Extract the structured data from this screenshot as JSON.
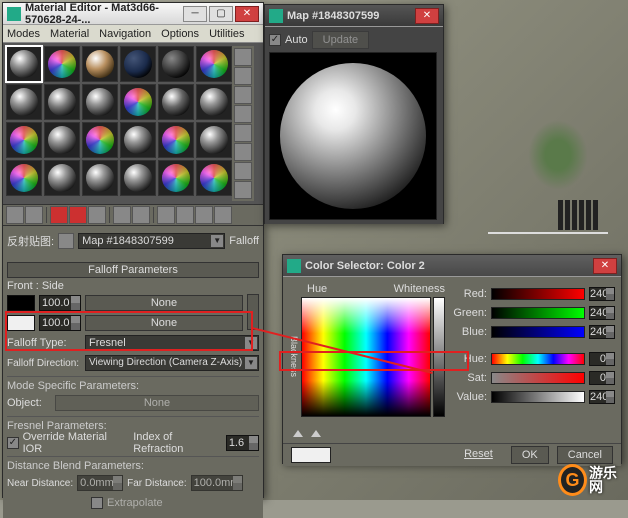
{
  "materialEditor": {
    "title": "Material Editor - Mat3d66-570628-24-...",
    "menu": [
      "Modes",
      "Material",
      "Navigation",
      "Options",
      "Utilities"
    ],
    "mapField": "Map #1848307599",
    "mapType": "Falloff",
    "reflectMapLabel": "反射贴图:",
    "falloffRoll": "Falloff Parameters",
    "frontSideLabel": "Front : Side",
    "slot1": {
      "value": "100.0",
      "map": "None"
    },
    "slot2": {
      "value": "100.0",
      "map": "None"
    },
    "falloffTypeLabel": "Falloff Type:",
    "falloffType": "Fresnel",
    "falloffDirLabel": "Falloff Direction:",
    "falloffDir": "Viewing Direction (Camera Z-Axis)",
    "modeSpecLabel": "Mode Specific Parameters:",
    "objectLabel": "Object:",
    "objectBtn": "None",
    "fresnelLabel": "Fresnel Parameters:",
    "overrideIOR": "Override Material IOR",
    "iorLabel": "Index of Refraction",
    "iorValue": "1.6",
    "distBlendLabel": "Distance Blend Parameters:",
    "nearDistLabel": "Near Distance:",
    "nearDist": "0.0mm",
    "farDistLabel": "Far Distance:",
    "farDist": "100.0mm",
    "extrapolate": "Extrapolate"
  },
  "mapPreview": {
    "title": "Map #1848307599",
    "auto": "Auto",
    "update": "Update"
  },
  "colorSelector": {
    "title": "Color Selector: Color 2",
    "hueLabel": "Hue",
    "whitenessLabel": "Whiteness",
    "blacknessLabel": "Blackness",
    "red": {
      "label": "Red:",
      "value": "240"
    },
    "green": {
      "label": "Green:",
      "value": "240"
    },
    "blue": {
      "label": "Blue:",
      "value": "240"
    },
    "hue": {
      "label": "Hue:",
      "value": "0"
    },
    "sat": {
      "label": "Sat:",
      "value": "0"
    },
    "value": {
      "label": "Value:",
      "value": "240"
    },
    "reset": "Reset",
    "ok": "OK",
    "cancel": "Cancel"
  },
  "logo": "游乐网"
}
